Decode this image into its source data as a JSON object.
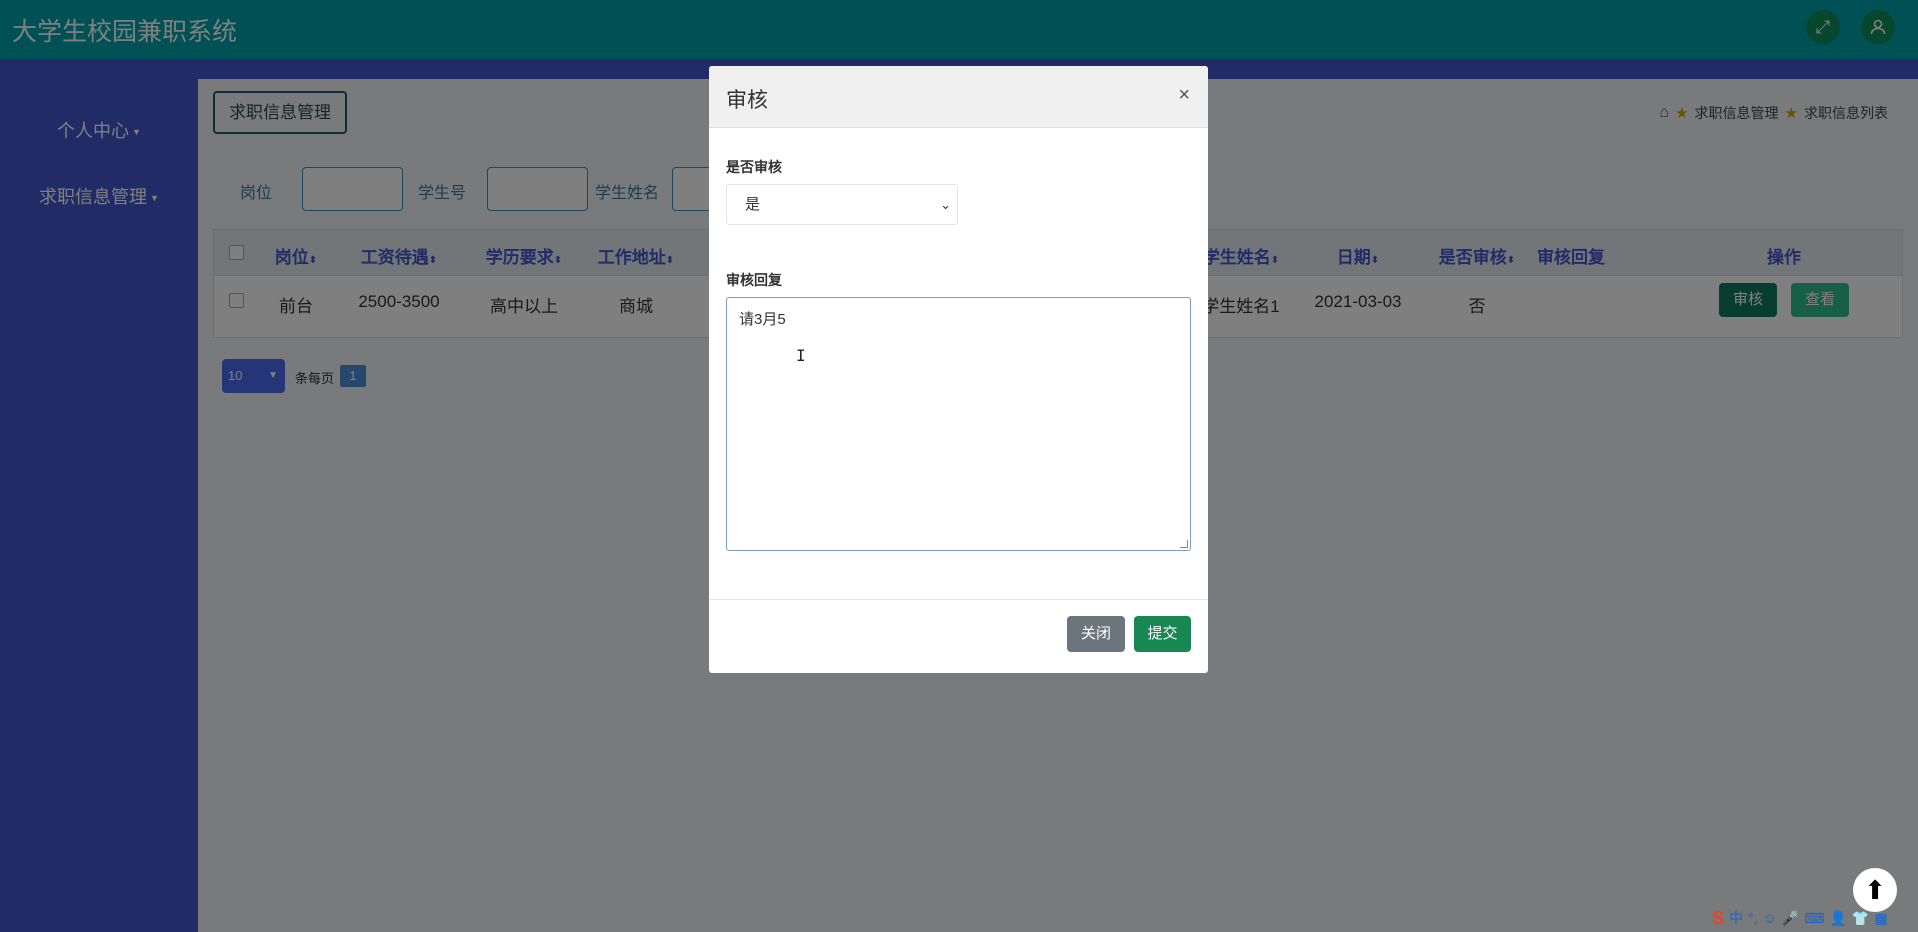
{
  "app": {
    "title": "大学生校园兼职系统"
  },
  "topbar_icons": {
    "fullscreen": "fullscreen-icon",
    "user": "user-icon"
  },
  "sidebar": {
    "items": [
      {
        "label": "个人中心"
      },
      {
        "label": "求职信息管理"
      }
    ]
  },
  "page": {
    "header_button": "求职信息管理",
    "breadcrumb": {
      "item1": "求职信息管理",
      "item2": "求职信息列表"
    }
  },
  "search": {
    "labels": {
      "position": "岗位",
      "student_no": "学生号",
      "student_name": "学生姓名"
    }
  },
  "table": {
    "columns": [
      "岗位",
      "工资待遇",
      "学历要求",
      "工作地址",
      "学生姓名",
      "日期",
      "是否审核",
      "审核回复",
      "操作"
    ],
    "rows": [
      {
        "position": "前台",
        "salary": "2500-3500",
        "education": "高中以上",
        "address": "商城",
        "student_name": "学生姓名1",
        "date": "2021-03-03",
        "audited": "否",
        "reply": "",
        "actions": {
          "audit": "审核",
          "view": "查看"
        }
      }
    ]
  },
  "pagination": {
    "page_size": "10",
    "per_page_label": "条每页",
    "current_page": "1"
  },
  "modal": {
    "title": "审核",
    "close_symbol": "×",
    "audit_label": "是否审核",
    "audit_value": "是",
    "reply_label": "审核回复",
    "reply_value": "请3月5",
    "buttons": {
      "close": "关闭",
      "submit": "提交"
    }
  },
  "colors": {
    "topbar": "#00a2ab",
    "sidebar": "#4258cf",
    "audit_button": "#0c7a5e",
    "view_button": "#2fbf8c",
    "submit_button": "#198754",
    "close_button": "#6c757d"
  }
}
